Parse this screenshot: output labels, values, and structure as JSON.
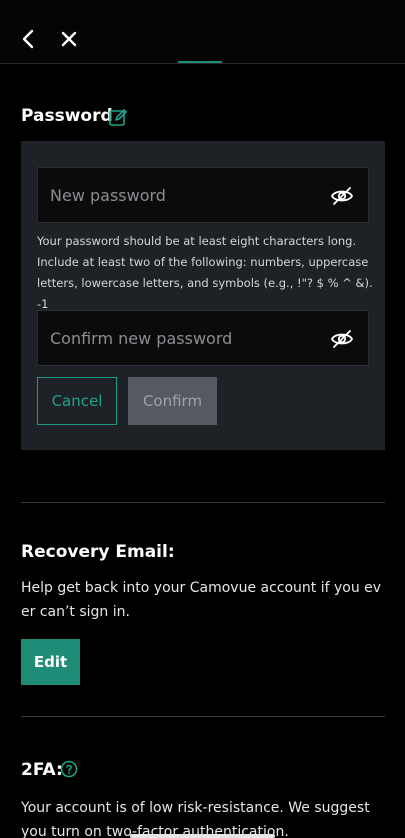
{
  "header": {
    "back_icon": "chevron-left-icon",
    "close_icon": "close-icon"
  },
  "password": {
    "title": "Password",
    "edit_icon": "edit-icon",
    "new_placeholder": "New password",
    "hint": "Your password should be at least eight characters long. Include at least two of the following: numbers, uppercase letters, lowercase letters, and symbols (e.g., !\"? $ % ^ &). -1",
    "confirm_placeholder": "Confirm new password",
    "eye_icon": "eye-off-icon",
    "cancel_label": "Cancel",
    "confirm_label": "Confirm"
  },
  "recovery": {
    "title": "Recovery Email:",
    "description": "Help get back into your Camovue account if you ever can’t sign in.",
    "edit_label": "Edit"
  },
  "twofa": {
    "title": "2FA:",
    "help_icon": "question-circle-icon",
    "description": "Your account is of low risk-resistance. We suggest you turn on two-factor authentication."
  },
  "colors": {
    "accent": "#1f8c78",
    "panel": "#1e2126",
    "background": "#000000",
    "disabled_button": "#565a60"
  }
}
